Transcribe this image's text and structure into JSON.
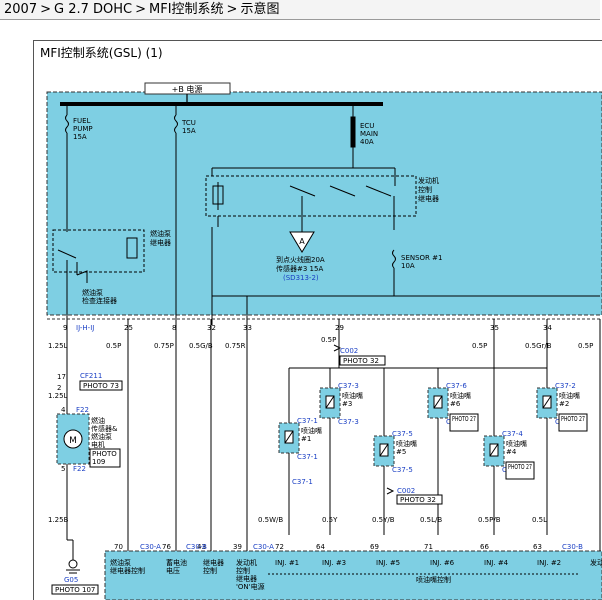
{
  "breadcrumb": [
    "2007",
    "G 2.7 DOHC",
    "MFI控制系统",
    "示意图"
  ],
  "diagram": {
    "title": "MFI控制系统(GSL) (1)",
    "power_label": "+B 电源",
    "fuses": [
      {
        "lines": [
          "FUEL",
          "PUMP",
          "15A"
        ]
      },
      {
        "lines": [
          "TCU",
          "15A"
        ]
      },
      {
        "lines": [
          "ECU",
          "MAIN",
          "40A"
        ]
      },
      {
        "lines": [
          "SENSOR #1",
          "10A"
        ]
      }
    ],
    "relay_engine": [
      "发动机",
      "控制",
      "继电器"
    ],
    "relay_fuelpump": [
      "燃油泵",
      "继电器"
    ],
    "fuelpump_connector": [
      "燃油泵",
      "检查连接器"
    ],
    "ignition_ref": [
      "到点火线圈20A",
      "传感器#3 15A"
    ],
    "ignition_link": "(SD313-2)",
    "pins_top": [
      "9",
      "25",
      "8",
      "32",
      "33",
      "29",
      "35",
      "34",
      "17"
    ],
    "wires_top": [
      "1.25L",
      "0.5P",
      "0.75P",
      "0.5G/B",
      "0.75R",
      "0.5P",
      "0.5P",
      "0.5Gr/B",
      "0.5P"
    ],
    "jj_label": "IJ-H-IJ",
    "c002_top": "C002",
    "photo32_top": "PHOTO 32",
    "cf211": "CF211",
    "photo73": "PHOTO 73",
    "wire_125l_mid": "1.25L",
    "pin_17": "17",
    "pin_2_cf": "2",
    "f22_top": "F22",
    "f22_bot": "F22",
    "pin_4_f22": "4",
    "pin_5_f22": "5",
    "fuelpump_motor_label": [
      "燃油",
      "传感器&",
      "燃油泵",
      "电机"
    ],
    "photo109": [
      "PHOTO",
      "109"
    ],
    "motor_symbol": "M",
    "injectors": [
      {
        "conn": "C37-1",
        "name": [
          "喷油嘴",
          "#1"
        ],
        "photo": ""
      },
      {
        "conn": "C37-3",
        "name": [
          "喷油嘴",
          "#3"
        ],
        "photo": ""
      },
      {
        "conn": "C37-5",
        "name": [
          "喷油嘴",
          "#5"
        ],
        "photo": ""
      },
      {
        "conn": "C37-6",
        "name": [
          "喷油嘴",
          "#6"
        ],
        "photo": "PHOTO 27"
      },
      {
        "conn": "C37-4",
        "name": [
          "喷油嘴",
          "#4"
        ],
        "photo": "PHOTO 27"
      },
      {
        "conn": "C37-2",
        "name": [
          "喷油嘴",
          "#2"
        ],
        "photo": "PHOTO 27"
      }
    ],
    "c002_bot": "C002",
    "photo32_bot": "PHOTO 32",
    "c37_1_bot": "C37-1",
    "wires_bottom": [
      "1.25B",
      "0.5W/B",
      "0.5Y",
      "0.5Y/B",
      "0.5L/B",
      "0.5P/B",
      "0.5L"
    ],
    "ecu_pins": [
      "70",
      "76",
      "43",
      "39",
      "72",
      "64",
      "69",
      "71",
      "66",
      "63"
    ],
    "ecu_conns": [
      "C30-A",
      "C30-B",
      "C30-A",
      "C30-B"
    ],
    "ecu_labels": [
      [
        "燃油泵",
        "继电器控制"
      ],
      [
        "蓄电池",
        "电压"
      ],
      [
        "继电器",
        "控制"
      ],
      [
        "发动机",
        "控制",
        "继电器",
        "'ON'电源"
      ],
      [
        "INJ. #1"
      ],
      [
        "INJ. #3"
      ],
      [
        "INJ. #5"
      ],
      [
        "INJ. #6"
      ],
      [
        "INJ. #4"
      ],
      [
        "INJ. #2"
      ],
      [
        "发动"
      ]
    ],
    "injector_control_label": "喷油嘴控制",
    "ground_label": "G05",
    "photo107": "PHOTO 107"
  }
}
